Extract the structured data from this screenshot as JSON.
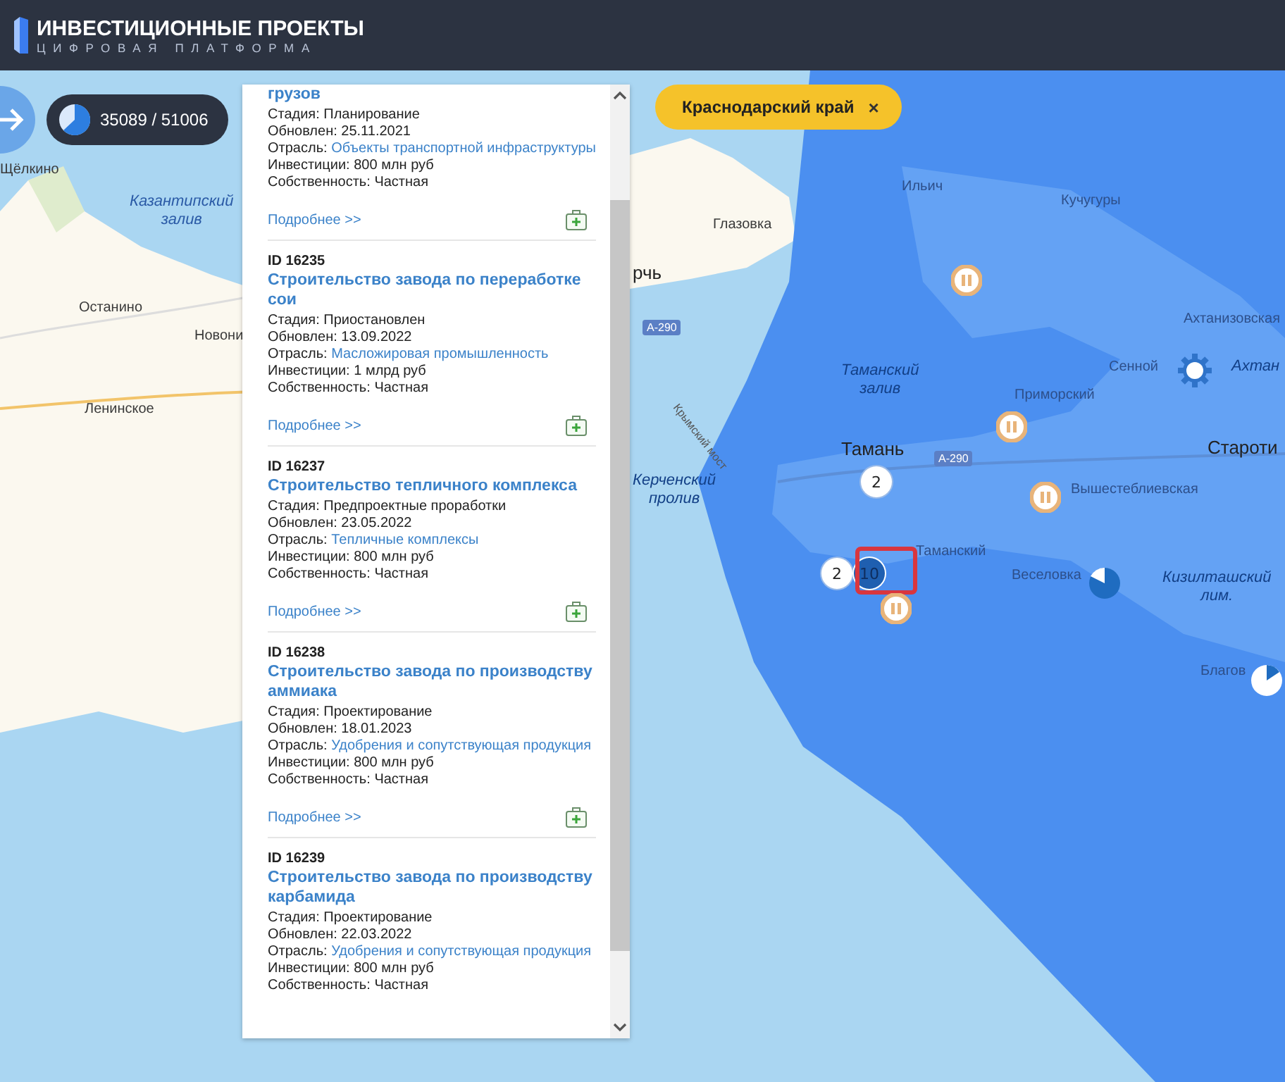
{
  "header": {
    "title": "ИНВЕСТИЦИОННЫЕ ПРОЕКТЫ",
    "subtitle": "ЦИФРОВАЯ ПЛАТФОРМА"
  },
  "counter": {
    "text": "35089 / 51006"
  },
  "region_filter": {
    "label": "Краснодарский край",
    "close": "×"
  },
  "projects": [
    {
      "title": "грузов",
      "fields": [
        {
          "label": "Стадия:",
          "value": "Планирование",
          "link": false
        },
        {
          "label": "Обновлен:",
          "value": "25.11.2021",
          "link": false
        },
        {
          "label": "Отрасль:",
          "value": "Объекты транспортной инфраструктуры",
          "link": true
        },
        {
          "label": "Инвестиции:",
          "value": "800 млн руб",
          "link": false
        },
        {
          "label": "Собственность:",
          "value": "Частная",
          "link": false
        }
      ],
      "more": "Подробнее >>"
    },
    {
      "id": "ID 16235",
      "title": "Строительство завода по переработке сои",
      "fields": [
        {
          "label": "Стадия:",
          "value": "Приостановлен",
          "link": false
        },
        {
          "label": "Обновлен:",
          "value": "13.09.2022",
          "link": false
        },
        {
          "label": "Отрасль:",
          "value": "Масложировая промышленность",
          "link": true
        },
        {
          "label": "Инвестиции:",
          "value": "1 млрд руб",
          "link": false
        },
        {
          "label": "Собственность:",
          "value": "Частная",
          "link": false
        }
      ],
      "more": "Подробнее >>"
    },
    {
      "id": "ID 16237",
      "title": "Строительство тепличного комплекса",
      "fields": [
        {
          "label": "Стадия:",
          "value": "Предпроектные проработки",
          "link": false
        },
        {
          "label": "Обновлен:",
          "value": "23.05.2022",
          "link": false
        },
        {
          "label": "Отрасль:",
          "value": "Тепличные комплексы",
          "link": true
        },
        {
          "label": "Инвестиции:",
          "value": "800 млн руб",
          "link": false
        },
        {
          "label": "Собственность:",
          "value": "Частная",
          "link": false
        }
      ],
      "more": "Подробнее >>"
    },
    {
      "id": "ID 16238",
      "title": "Строительство завода по производству аммиака",
      "fields": [
        {
          "label": "Стадия:",
          "value": "Проектирование",
          "link": false
        },
        {
          "label": "Обновлен:",
          "value": "18.01.2023",
          "link": false
        },
        {
          "label": "Отрасль:",
          "value": "Удобрения и сопутствующая продукция",
          "link": true
        },
        {
          "label": "Инвестиции:",
          "value": "800 млн руб",
          "link": false
        },
        {
          "label": "Собственность:",
          "value": "Частная",
          "link": false
        }
      ],
      "more": "Подробнее >>"
    },
    {
      "id": "ID 16239",
      "title": "Строительство завода по производству карбамида",
      "fields": [
        {
          "label": "Стадия:",
          "value": "Проектирование",
          "link": false
        },
        {
          "label": "Обновлен:",
          "value": "22.03.2022",
          "link": false
        },
        {
          "label": "Отрасль:",
          "value": "Удобрения и сопутствующая продукция",
          "link": true
        },
        {
          "label": "Инвестиции:",
          "value": "800 млн руб",
          "link": false
        },
        {
          "label": "Собственность:",
          "value": "Частная",
          "link": false
        }
      ]
    }
  ],
  "map_labels": [
    {
      "text": "Щёлкино",
      "kind": "town"
    },
    {
      "text": "Казантипский залив",
      "kind": "water"
    },
    {
      "text": "Останино",
      "kind": "town"
    },
    {
      "text": "Новони",
      "kind": "town"
    },
    {
      "text": "Ленинское",
      "kind": "town"
    },
    {
      "text": "Глазовка",
      "kind": "town"
    },
    {
      "text": "рчь",
      "kind": "city"
    },
    {
      "text": "А-290",
      "kind": "road"
    },
    {
      "text": "А-290",
      "kind": "road"
    },
    {
      "text": "Крымский мост",
      "kind": "bridge"
    },
    {
      "text": "Ильич",
      "kind": "town"
    },
    {
      "text": "Кучугуры",
      "kind": "town"
    },
    {
      "text": "Таманский залив",
      "kind": "water"
    },
    {
      "text": "Ахтанизовская",
      "kind": "town"
    },
    {
      "text": "Сенной",
      "kind": "town"
    },
    {
      "text": "Ахтан",
      "kind": "water"
    },
    {
      "text": "Приморский",
      "kind": "town"
    },
    {
      "text": "Тамань",
      "kind": "city"
    },
    {
      "text": "Староти",
      "kind": "city"
    },
    {
      "text": "Керченский пролив",
      "kind": "water"
    },
    {
      "text": "Вышестеблиевская",
      "kind": "town"
    },
    {
      "text": "Таманский",
      "kind": "town"
    },
    {
      "text": "Веселовка",
      "kind": "town"
    },
    {
      "text": "Кизилташский лим.",
      "kind": "water"
    },
    {
      "text": "Благов",
      "kind": "town"
    }
  ],
  "markers": [
    {
      "kind": "cluster",
      "count": "2",
      "selected": false
    },
    {
      "kind": "cluster",
      "count": "2",
      "selected": false
    },
    {
      "kind": "cluster",
      "count": "10",
      "selected": true
    },
    {
      "kind": "paused",
      "selected": false
    },
    {
      "kind": "paused",
      "selected": false
    },
    {
      "kind": "paused",
      "selected": false
    },
    {
      "kind": "paused",
      "selected": false
    },
    {
      "kind": "cog",
      "selected": false
    },
    {
      "kind": "pie",
      "selected": false
    },
    {
      "kind": "pie",
      "selected": false
    }
  ]
}
